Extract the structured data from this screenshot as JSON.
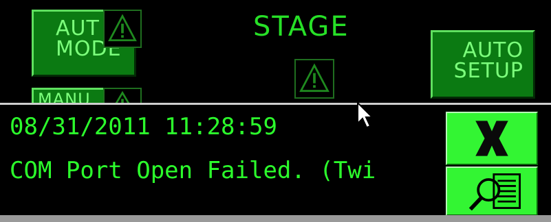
{
  "top": {
    "stage_title": "STAGE",
    "auto_mode": {
      "line1": "AUT",
      "line2": "MODE"
    },
    "auto_setup": {
      "line1": "AUTO",
      "line2": "SETUP"
    },
    "manual_partial": "MANU"
  },
  "message": {
    "timestamp": "08/31/2011 11:28:59",
    "text": "COM Port Open Failed. (Twi"
  },
  "buttons": {
    "close_icon": "x-close-icon",
    "details_icon": "magnifier-document-icon"
  },
  "colors": {
    "text_green": "#2cff2c",
    "button_green": "#0b7a12",
    "side_button_green": "#33f533"
  }
}
